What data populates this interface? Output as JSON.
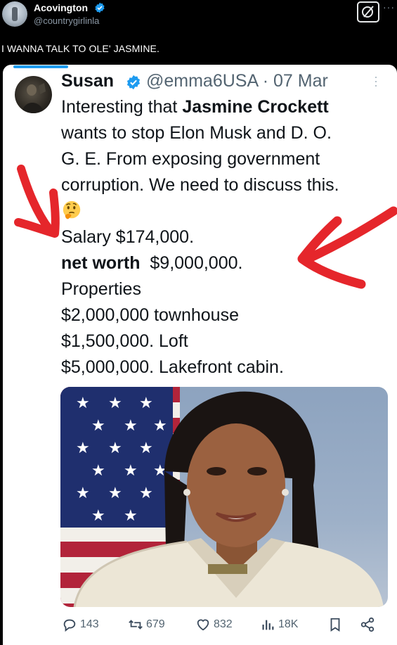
{
  "outer_post": {
    "author_name": "Acovington",
    "author_handle": "@countrygirlinla",
    "text": "I WANNA TALK TO OLE' JASMINE.",
    "icons": [
      "verified-badge-icon",
      "grok-icon",
      "more-icon"
    ]
  },
  "embedded_tweet": {
    "author_name": "Susan",
    "author_handle": "@emma6USA",
    "separator": "·",
    "date": "07 Mar",
    "body": {
      "intro_1": "Interesting that ",
      "intro_bold": "Jasmine Crockett",
      "line_2": "wants to stop Elon Musk and D. O.",
      "line_3": "G. E. From exposing government",
      "line_4": "corruption.  We need to discuss this.",
      "emoji": "thinking-face-icon",
      "salary": "Salary $174,000.",
      "net_worth_label": "net worth",
      "net_worth_value": "  $9,000,000.",
      "properties": "Properties",
      "property_1": "$2,000,000 townhouse",
      "property_2": "$1,500,000. Loft",
      "property_3": "$5,000,000. Lakefront cabin."
    },
    "image": "portrait-photo-with-american-flag",
    "actions": {
      "replies": "143",
      "reposts": "679",
      "likes": "832",
      "views": "18K"
    }
  },
  "colors": {
    "outer_bg": "#000000",
    "card_bg": "#ffffff",
    "accent_blue": "#1d9bf0",
    "arrow_red": "#e5262b",
    "muted_text": "#536471"
  }
}
